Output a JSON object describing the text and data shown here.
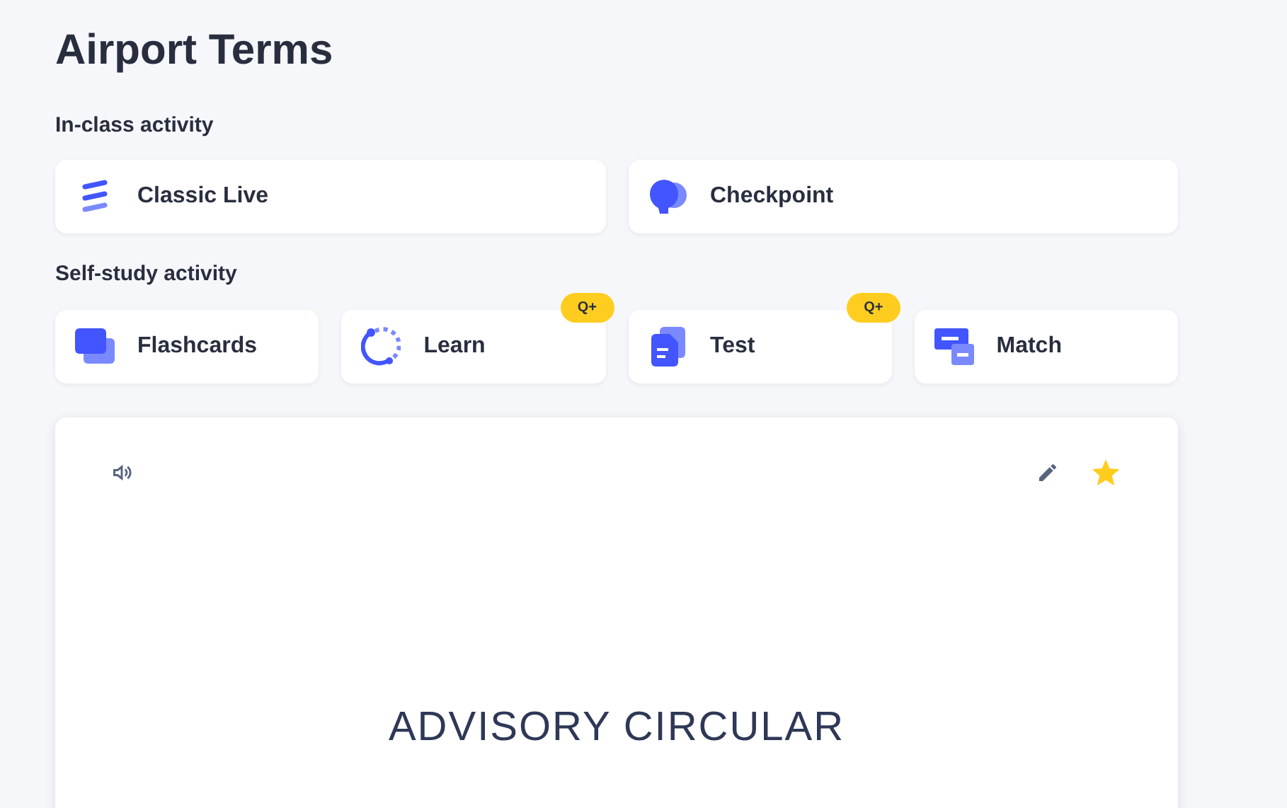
{
  "title": "Airport Terms",
  "in_class": {
    "heading": "In-class activity",
    "items": [
      {
        "kind": "live",
        "label": "Classic Live"
      },
      {
        "kind": "checkpoint",
        "label": "Checkpoint"
      }
    ]
  },
  "self_study": {
    "heading": "Self-study activity",
    "items": [
      {
        "kind": "flashcards",
        "label": "Flashcards"
      },
      {
        "kind": "learn",
        "label": "Learn",
        "badge": "Q+"
      },
      {
        "kind": "test",
        "label": "Test",
        "badge": "Q+"
      },
      {
        "kind": "match",
        "label": "Match"
      }
    ]
  },
  "flashcard": {
    "term": "ADVISORY CIRCULAR",
    "starred": true
  }
}
